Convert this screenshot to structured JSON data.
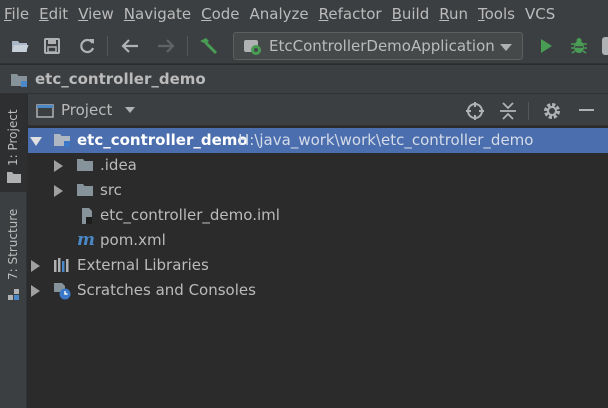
{
  "menu": {
    "items": [
      {
        "label": "File",
        "u": "F",
        "rest": "ile"
      },
      {
        "label": "Edit",
        "u": "E",
        "rest": "dit"
      },
      {
        "label": "View",
        "u": "V",
        "rest": "iew"
      },
      {
        "label": "Navigate",
        "u": "N",
        "rest": "avigate"
      },
      {
        "label": "Code",
        "u": "C",
        "rest": "ode"
      },
      {
        "label": "Analyze",
        "u": "",
        "rest": "Analyze"
      },
      {
        "label": "Refactor",
        "u": "R",
        "rest": "efactor"
      },
      {
        "label": "Build",
        "u": "B",
        "rest": "uild"
      },
      {
        "label": "Run",
        "u": "R",
        "rest": "un"
      },
      {
        "label": "Tools",
        "u": "T",
        "rest": "ools"
      },
      {
        "label": "VCS",
        "u": "",
        "rest": "VCS"
      }
    ]
  },
  "toolbar": {
    "run_config": "EtcControllerDemoApplication",
    "icons": [
      "open-folder-icon",
      "save-icon",
      "sync-icon",
      "back-arrow-icon",
      "forward-arrow-icon",
      "build-hammer-icon",
      "run-icon",
      "debug-icon"
    ]
  },
  "breadcrumb": {
    "project": "etc_controller_demo"
  },
  "left_strip": {
    "project_tab": "1: Project",
    "structure_tab": "7: Structure"
  },
  "panel": {
    "title": "Project"
  },
  "tree": {
    "root_name": "etc_controller_demo",
    "root_path": "H:\\java_work\\work\\etc_controller_demo",
    "idea": ".idea",
    "src": "src",
    "iml": "etc_controller_demo.iml",
    "pom": "pom.xml",
    "external_libraries": "External Libraries",
    "scratches": "Scratches and Consoles"
  },
  "colors": {
    "background": "#2b2b2b",
    "chrome": "#3c3f41",
    "selection": "#4b6eaf",
    "run_green": "#499c54",
    "folder": "#87939a"
  }
}
